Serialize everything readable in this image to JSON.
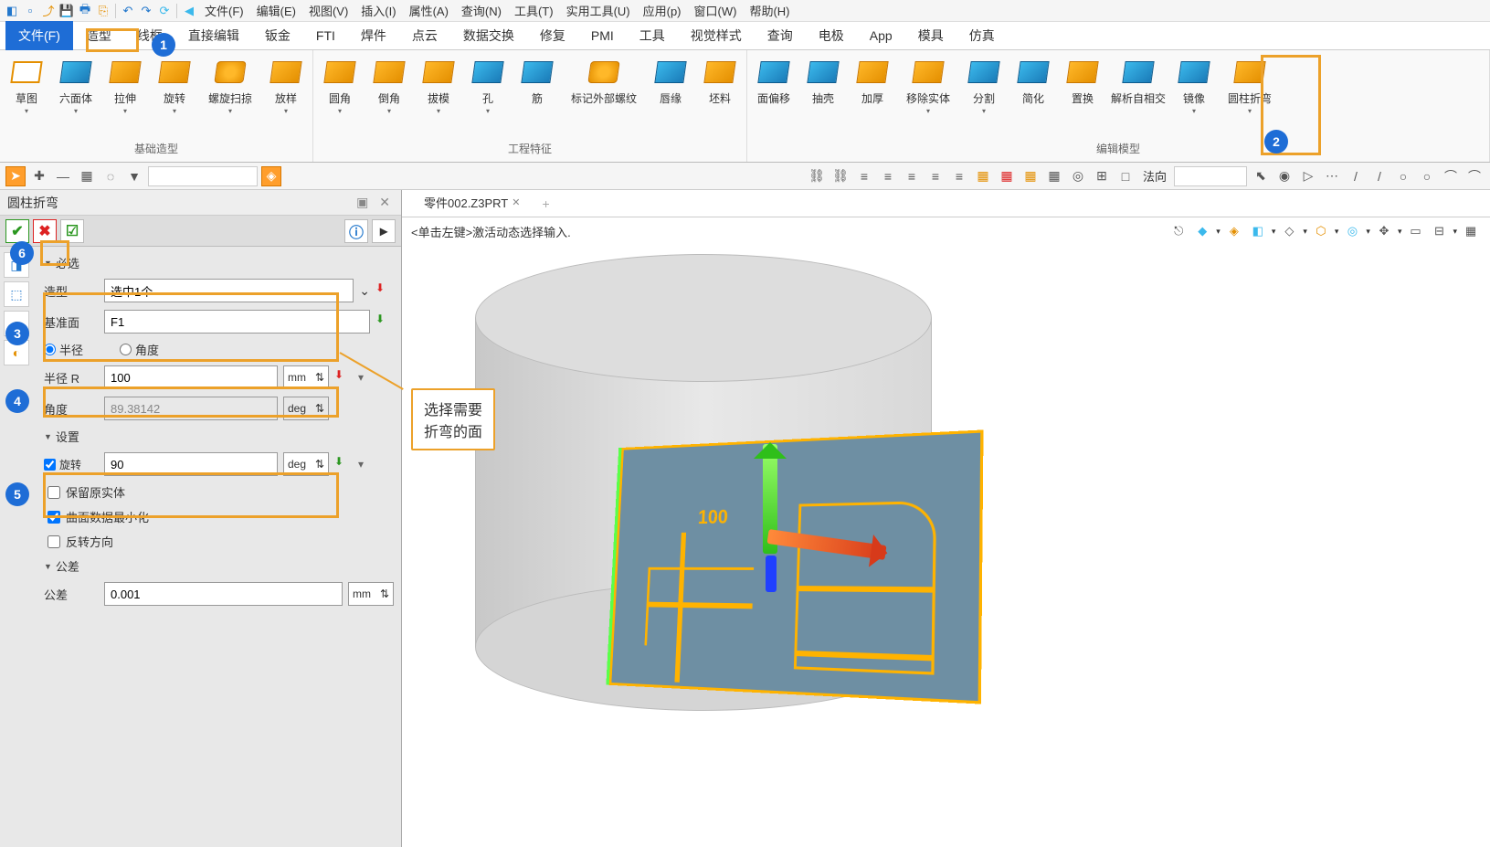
{
  "sysmenu": {
    "items": [
      "文件(F)",
      "编辑(E)",
      "视图(V)",
      "插入(I)",
      "属性(A)",
      "查询(N)",
      "工具(T)",
      "实用工具(U)",
      "应用(p)",
      "窗口(W)",
      "帮助(H)"
    ]
  },
  "ribbon_tabs": [
    "文件(F)",
    "造型",
    "线框",
    "直接编辑",
    "钣金",
    "FTI",
    "焊件",
    "点云",
    "数据交换",
    "修复",
    "PMI",
    "工具",
    "视觉样式",
    "查询",
    "电极",
    "App",
    "模具",
    "仿真"
  ],
  "active_tab_index": 1,
  "groups": {
    "g1": {
      "label": "基础造型",
      "items": [
        "草图",
        "六面体",
        "拉伸",
        "旋转",
        "螺旋扫掠",
        "放样"
      ]
    },
    "g2": {
      "label": "工程特征",
      "items": [
        "圆角",
        "倒角",
        "拔模",
        "孔",
        "筋",
        "标记外部螺纹",
        "唇缘",
        "坯料"
      ]
    },
    "g3": {
      "label": "编辑模型",
      "items": [
        "面偏移",
        "抽壳",
        "加厚",
        "移除实体",
        "分割",
        "简化",
        "置换",
        "解析自相交",
        "镜像",
        "圆柱折弯"
      ]
    }
  },
  "normal_label": "法向",
  "panel": {
    "title": "圆柱折弯",
    "req_header": "必选",
    "shape_label": "造型",
    "shape_value": "选中1个",
    "datum_label": "基准面",
    "datum_value": "F1",
    "radius_radio": "半径",
    "angle_radio": "角度",
    "radius_label": "半径 R",
    "radius_value": "100",
    "radius_unit": "mm",
    "angle_label": "角度",
    "angle_value": "89.38142",
    "angle_unit": "deg",
    "settings_header": "设置",
    "rotate_label": "旋转",
    "rotate_value": "90",
    "rotate_unit": "deg",
    "keep_label": "保留原实体",
    "minimize_label": "曲面数据最小化",
    "reverse_label": "反转方向",
    "tol_header": "公差",
    "tol_label": "公差",
    "tol_value": "0.001",
    "tol_unit": "mm"
  },
  "tab": {
    "name": "零件002.Z3PRT"
  },
  "hint": "<单击左键>激活动态选择输入.",
  "dim_label": "100",
  "callout": {
    "line1": "选择需要",
    "line2": "折弯的面"
  },
  "badges": [
    "1",
    "2",
    "3",
    "4",
    "5",
    "6"
  ]
}
